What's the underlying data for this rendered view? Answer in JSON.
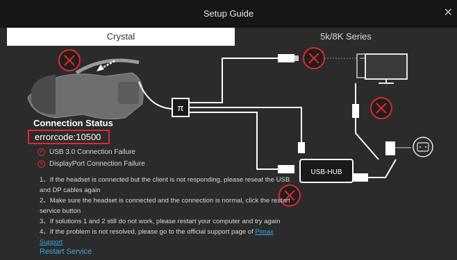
{
  "window": {
    "title": "Setup Guide",
    "close_glyph": "✕"
  },
  "tabs": [
    {
      "label": "Crystal",
      "active": true
    },
    {
      "label": "5k/8K Series",
      "active": false
    }
  ],
  "diagram": {
    "hub_label": "USB-HUB",
    "splitter_label": "π"
  },
  "status": {
    "heading": "Connection Status",
    "error_code": "errorcode:10500",
    "failures": [
      "USB 3.0 Connection Failure",
      "DisplayPort Connection Failure"
    ]
  },
  "instructions": {
    "line1": "1、If the headset is connected but the client is not responding, please reseat the USB",
    "line1b": "and DP cables again",
    "line2": "2、Make sure the headset is connected and the connection is normal, click the restart",
    "line2b": "service button",
    "line3": "3、If solutions 1 and 2 still do not work, please restart your computer and try again",
    "line4": "4、If the problem is not resolved, please go to the official support page of ",
    "link_part1": "Pimax",
    "link_part2": "Support"
  },
  "actions": {
    "restart": "Restart Service"
  },
  "colors": {
    "error_red": "#e0282a",
    "link_blue": "#3aa3e6",
    "background": "#2b2b2b"
  }
}
